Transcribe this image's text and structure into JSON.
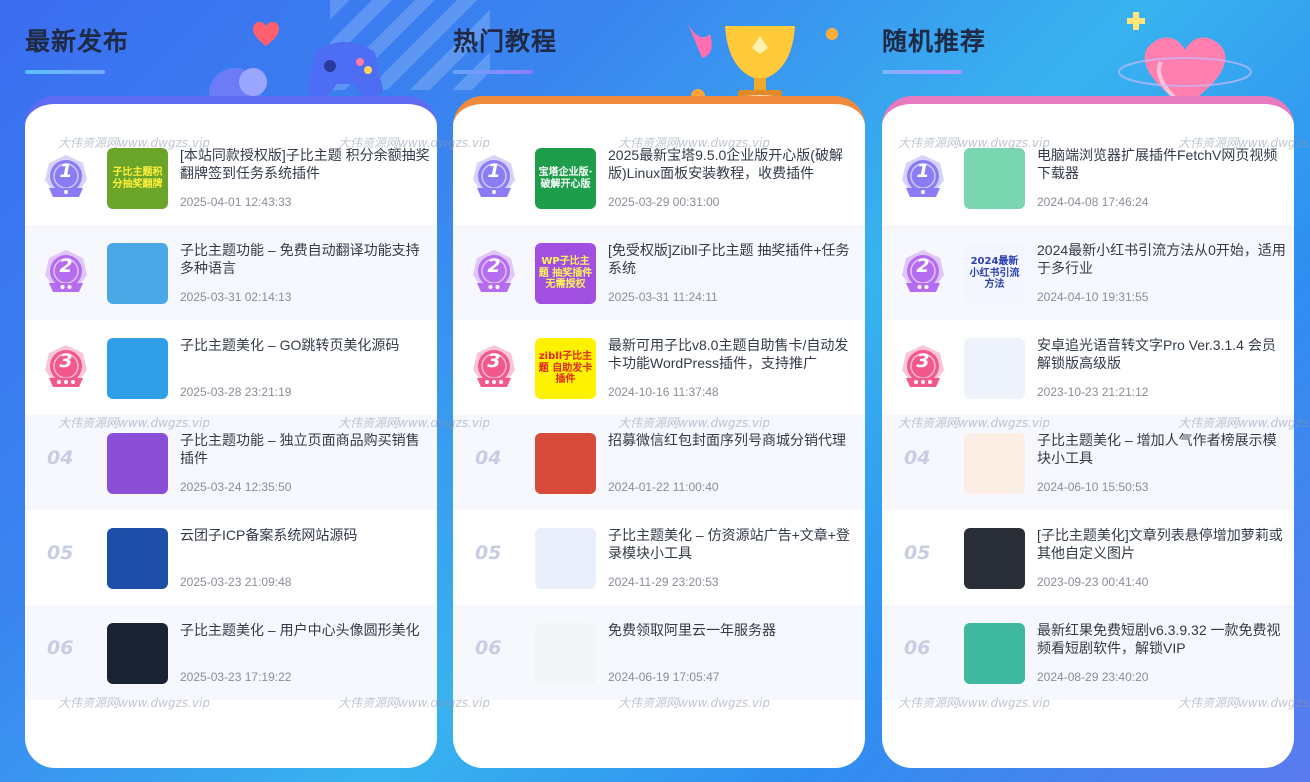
{
  "columns": [
    {
      "title": "最新发布",
      "items": [
        {
          "rank": "1",
          "title": "[本站同款授权版]子比主题 积分余额抽奖翻牌签到任务系统插件",
          "date": "2025-04-01 12:43:33",
          "thumb_text": "子比主题积分抽奖翻牌",
          "thumb_bg": "#6aa52a",
          "thumb_fg": "#ffef3a"
        },
        {
          "rank": "2",
          "title": "子比主题功能 – 免费自动翻译功能支持多种语言",
          "date": "2025-03-31 02:14:13",
          "thumb_text": "",
          "thumb_bg": "#4aa8e6",
          "thumb_fg": "#ffffff"
        },
        {
          "rank": "3",
          "title": "子比主题美化 – GO跳转页美化源码",
          "date": "2025-03-28 23:21:19",
          "thumb_text": "",
          "thumb_bg": "#2fa0e8",
          "thumb_fg": "#ffffff"
        },
        {
          "rank": "04",
          "title": "子比主题功能 – 独立页面商品购买销售插件",
          "date": "2025-03-24 12:35:50",
          "thumb_text": "",
          "thumb_bg": "#8a4fd6",
          "thumb_fg": "#ffffff"
        },
        {
          "rank": "05",
          "title": "云团子ICP备案系统网站源码",
          "date": "2025-03-23 21:09:48",
          "thumb_text": "",
          "thumb_bg": "#1d4fa8",
          "thumb_fg": "#ffffff"
        },
        {
          "rank": "06",
          "title": "子比主题美化 – 用户中心头像圆形美化",
          "date": "2025-03-23 17:19:22",
          "thumb_text": "",
          "thumb_bg": "#1a2333",
          "thumb_fg": "#ffffff"
        }
      ]
    },
    {
      "title": "热门教程",
      "items": [
        {
          "rank": "1",
          "title": "2025最新宝塔9.5.0企业版开心版(破解版)Linux面板安装教程，收费插件",
          "date": "2025-03-29 00:31:00",
          "thumb_text": "宝塔企业版·破解开心版",
          "thumb_bg": "#1e9e4a",
          "thumb_fg": "#ffffff"
        },
        {
          "rank": "2",
          "title": "[免受权版]Zibll子比主题 抽奖插件+任务系统",
          "date": "2025-03-31 11:24:11",
          "thumb_text": "WP子比主题 抽奖插件 无需授权",
          "thumb_bg": "#a04fe0",
          "thumb_fg": "#fff35a"
        },
        {
          "rank": "3",
          "title": "最新可用子比v8.0主题自助售卡/自动发卡功能WordPress插件，支持推广",
          "date": "2024-10-16 11:37:48",
          "thumb_text": "zibll子比主题 自助发卡插件",
          "thumb_bg": "#fff200",
          "thumb_fg": "#e0261f"
        },
        {
          "rank": "04",
          "title": "招募微信红包封面序列号商城分销代理",
          "date": "2024-01-22 11:00:40",
          "thumb_text": "",
          "thumb_bg": "#d84a3a",
          "thumb_fg": "#ffffff"
        },
        {
          "rank": "05",
          "title": "子比主题美化 – 仿资源站广告+文章+登录模块小工具",
          "date": "2024-11-29 23:20:53",
          "thumb_text": "",
          "thumb_bg": "#e9eefb",
          "thumb_fg": "#3a4a8a"
        },
        {
          "rank": "06",
          "title": "免费领取阿里云一年服务器",
          "date": "2024-06-19 17:05:47",
          "thumb_text": "",
          "thumb_bg": "#f2f4f8",
          "thumb_fg": "#9aa0aa"
        }
      ]
    },
    {
      "title": "随机推荐",
      "items": [
        {
          "rank": "1",
          "title": "电脑端浏览器扩展插件FetchV网页视频下载器",
          "date": "2024-04-08 17:46:24",
          "thumb_text": "",
          "thumb_bg": "#7ad6b0",
          "thumb_fg": "#ffffff"
        },
        {
          "rank": "2",
          "title": "2024最新小红书引流方法从0开始，适用于多行业",
          "date": "2024-04-10 19:31:55",
          "thumb_text": "2024最新小红书引流方法",
          "thumb_bg": "#f4f6ff",
          "thumb_fg": "#2a3fb0"
        },
        {
          "rank": "3",
          "title": "安卓追光语音转文字Pro Ver.3.1.4 会员解锁版高级版",
          "date": "2023-10-23 21:21:12",
          "thumb_text": "",
          "thumb_bg": "#eef3fb",
          "thumb_fg": "#3a7ae0"
        },
        {
          "rank": "04",
          "title": "子比主题美化 – 增加人气作者榜展示模块小工具",
          "date": "2024-06-10 15:50:53",
          "thumb_text": "",
          "thumb_bg": "#fbeee4",
          "thumb_fg": "#e07a3a"
        },
        {
          "rank": "05",
          "title": "[子比主题美化]文章列表悬停增加萝莉或其他自定义图片",
          "date": "2023-09-23 00:41:40",
          "thumb_text": "",
          "thumb_bg": "#2a2e36",
          "thumb_fg": "#ffffff"
        },
        {
          "rank": "06",
          "title": "最新红果免费短剧v6.3.9.32 一款免费视频看短剧软件，解锁VIP",
          "date": "2024-08-29 23:40:20",
          "thumb_text": "",
          "thumb_bg": "#3fb8a0",
          "thumb_fg": "#ffffff"
        }
      ]
    }
  ],
  "watermark": "大伟资源网www.dwgzs.vip",
  "colors": {
    "rank1": "#8b7cf6",
    "rank2": "#b56cf0",
    "rank3": "#f2588a"
  }
}
